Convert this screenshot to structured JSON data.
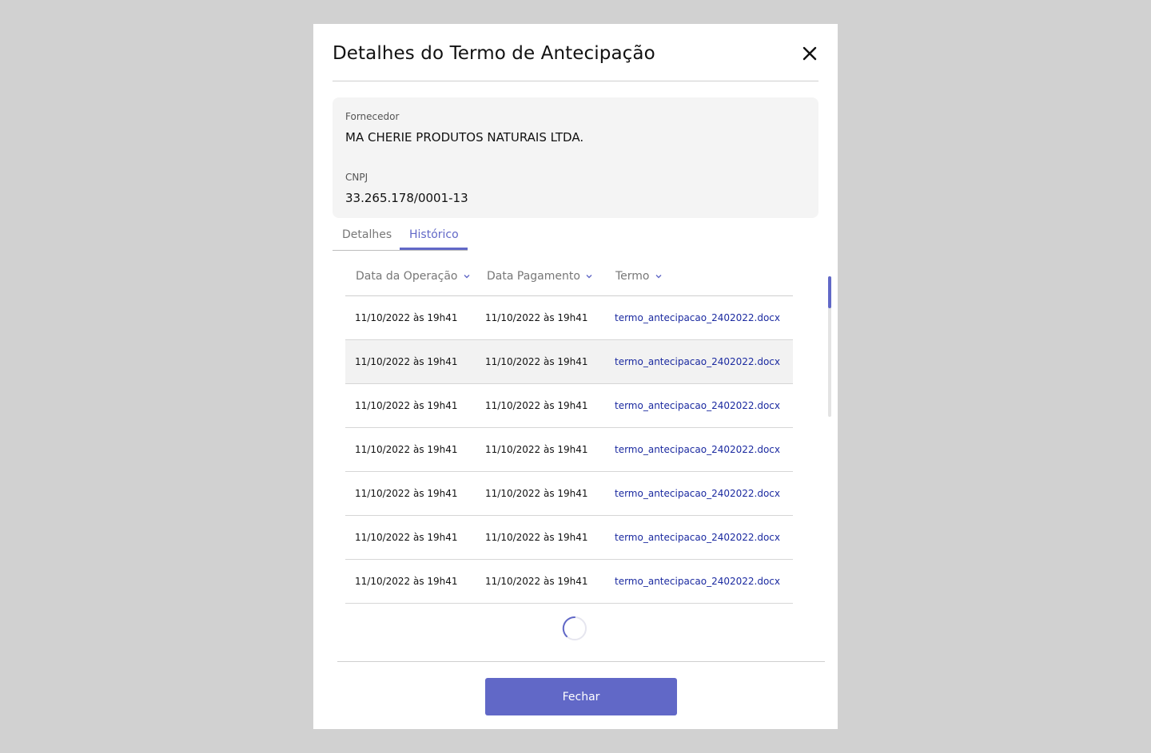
{
  "modal": {
    "title": "Detalhes do Termo de Antecipação",
    "close_icon": "close-icon"
  },
  "supplier": {
    "label": "Fornecedor",
    "value": "MA CHERIE PRODUTOS NATURAIS LTDA.",
    "cnpj_label": "CNPJ",
    "cnpj_value": "33.265.178/0001-13"
  },
  "tabs": [
    {
      "label": "Detalhes",
      "active": false
    },
    {
      "label": "Histórico",
      "active": true
    }
  ],
  "table": {
    "columns": [
      {
        "label": "Data da Operação",
        "icon": "chevron-down-icon"
      },
      {
        "label": "Data Pagamento",
        "icon": "chevron-down-icon"
      },
      {
        "label": "Termo",
        "icon": "chevron-down-icon"
      }
    ],
    "rows": [
      {
        "operacao": "11/10/2022 às 19h41",
        "pagamento": "11/10/2022 às 19h41",
        "termo": "termo_antecipacao_2402022.docx"
      },
      {
        "operacao": "11/10/2022 às 19h41",
        "pagamento": "11/10/2022 às 19h41",
        "termo": "termo_antecipacao_2402022.docx"
      },
      {
        "operacao": "11/10/2022 às 19h41",
        "pagamento": "11/10/2022 às 19h41",
        "termo": "termo_antecipacao_2402022.docx"
      },
      {
        "operacao": "11/10/2022 às 19h41",
        "pagamento": "11/10/2022 às 19h41",
        "termo": "termo_antecipacao_2402022.docx"
      },
      {
        "operacao": "11/10/2022 às 19h41",
        "pagamento": "11/10/2022 às 19h41",
        "termo": "termo_antecipacao_2402022.docx"
      },
      {
        "operacao": "11/10/2022 às 19h41",
        "pagamento": "11/10/2022 às 19h41",
        "termo": "termo_antecipacao_2402022.docx"
      },
      {
        "operacao": "11/10/2022 às 19h41",
        "pagamento": "11/10/2022 às 19h41",
        "termo": "termo_antecipacao_2402022.docx"
      }
    ],
    "loading_icon": "spinner-icon"
  },
  "footer": {
    "close_label": "Fechar"
  },
  "colors": {
    "accent": "#6168c7",
    "link": "#1b2aa0",
    "overlay": "#d1d1d1"
  }
}
